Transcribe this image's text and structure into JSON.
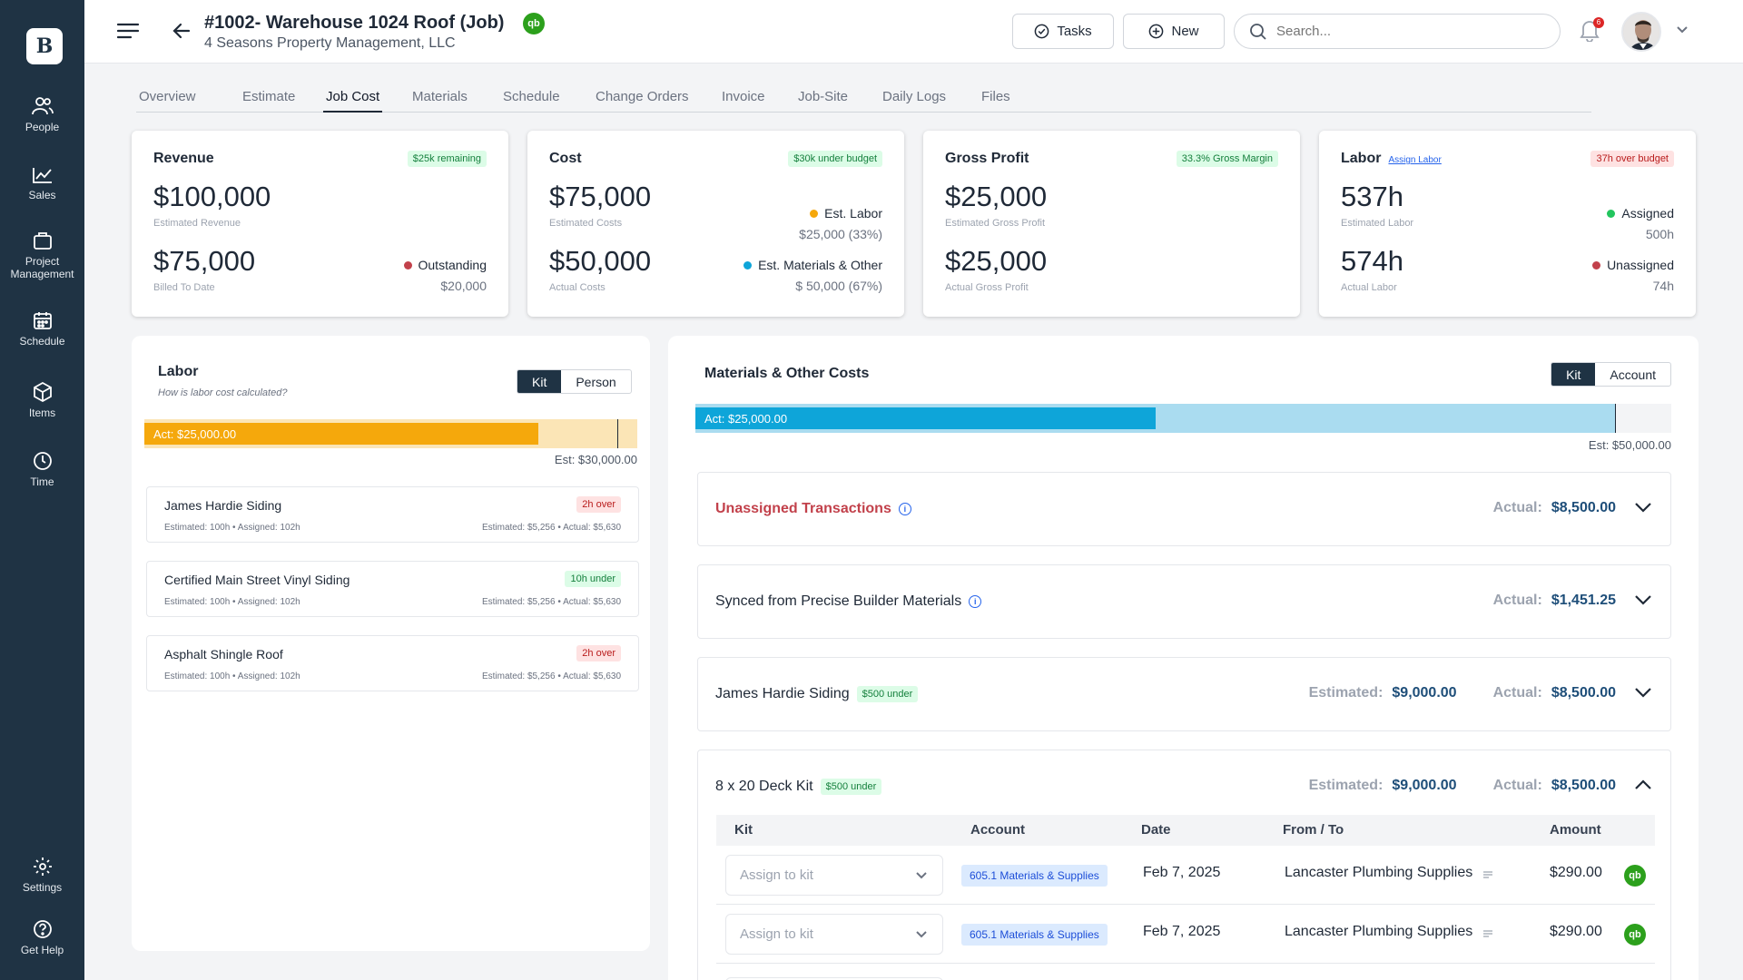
{
  "sidebar": {
    "logo": "B",
    "items": [
      {
        "label": "People",
        "icon": "people-icon"
      },
      {
        "label": "Sales",
        "icon": "chart-line-icon"
      },
      {
        "label": "Project Management",
        "icon": "briefcase-icon"
      },
      {
        "label": "Schedule",
        "icon": "calendar-icon"
      },
      {
        "label": "Items",
        "icon": "box-icon"
      },
      {
        "label": "Time",
        "icon": "clock-icon"
      },
      {
        "label": "Settings",
        "icon": "gear-icon"
      },
      {
        "label": "Get Help",
        "icon": "help-icon"
      }
    ]
  },
  "header": {
    "title": "#1002- Warehouse 1024 Roof (Job)",
    "subtitle": "4 Seasons Property Management, LLC",
    "qb_label": "qb",
    "tasks_label": "Tasks",
    "new_label": "New",
    "search_placeholder": "Search...",
    "notification_count": "6"
  },
  "tabs": [
    "Overview",
    "Estimate",
    "Job Cost",
    "Materials",
    "Schedule",
    "Change Orders",
    "Invoice",
    "Job-Site",
    "Daily Logs",
    "Files"
  ],
  "active_tab": "Job Cost",
  "cards": {
    "revenue": {
      "title": "Revenue",
      "pill": "$25k remaining",
      "est_value": "$100,000",
      "est_label": "Estimated Revenue",
      "act_value": "$75,000",
      "act_label": "Billed To Date",
      "legend": "Outstanding",
      "legend_value": "$20,000"
    },
    "cost": {
      "title": "Cost",
      "pill": "$30k under budget",
      "est_value": "$75,000",
      "est_label": "Estimated Costs",
      "act_value": "$50,000",
      "act_label": "Actual Costs",
      "legend1": "Est. Labor",
      "legend1_value": "$25,000 (33%)",
      "legend2": "Est. Materials & Other",
      "legend2_value": "$ 50,000 (67%)"
    },
    "gross": {
      "title": "Gross Profit",
      "pill": "33.3% Gross Margin",
      "est_value": "$25,000",
      "est_label": "Estimated Gross Profit",
      "act_value": "$25,000",
      "act_label": "Actual Gross Profit"
    },
    "labor": {
      "title": "Labor",
      "link": "Assign Labor",
      "pill": "37h over budget",
      "est_value": "537h",
      "est_label": "Estimated Labor",
      "act_value": "574h",
      "act_label": "Actual Labor",
      "legend1": "Assigned",
      "legend1_value": "500h",
      "legend2": "Unassigned",
      "legend2_value": "74h"
    }
  },
  "labor_panel": {
    "title": "Labor",
    "hint": "How is labor cost calculated?",
    "toggle": [
      "Kit",
      "Person"
    ],
    "bar_actual": "Act: $25,000.00",
    "bar_estimate": "Est: $30,000.00",
    "bar_fill_fraction": 0.833,
    "items": [
      {
        "name": "James Hardie Siding",
        "pill": "2h over",
        "status": "over",
        "hours": "Estimated: 100h  •  Assigned: 102h",
        "cost": "Estimated: $5,256  •  Actual: $5,630"
      },
      {
        "name": "Certified Main Street Vinyl Siding",
        "pill": "10h under",
        "status": "under",
        "hours": "Estimated: 100h  •  Assigned: 102h",
        "cost": "Estimated: $5,256  •  Actual: $5,630"
      },
      {
        "name": "Asphalt Shingle Roof",
        "pill": "2h over",
        "status": "over",
        "hours": "Estimated: 100h  •  Assigned: 102h",
        "cost": "Estimated: $5,256  •  Actual: $5,630"
      }
    ]
  },
  "materials_panel": {
    "title": "Materials & Other Costs",
    "toggle": [
      "Kit",
      "Account"
    ],
    "bar_actual": "Act: $25,000.00",
    "bar_estimate": "Est: $50,000.00",
    "bar_fill_fraction": 0.5,
    "actual_label": "Actual:",
    "estimated_label": "Estimated:",
    "rows": [
      {
        "name": "Unassigned Transactions",
        "actual": "$8,500.00"
      },
      {
        "name": "Synced from Precise Builder Materials",
        "actual": "$1,451.25"
      },
      {
        "name": "James Hardie Siding",
        "pill": "$500 under",
        "estimated": "$9,000.00",
        "actual": "$8,500.00"
      },
      {
        "name": "8 x 20 Deck Kit",
        "pill": "$500 under",
        "estimated": "$9,000.00",
        "actual": "$8,500.00"
      }
    ],
    "table": {
      "headers": [
        "Kit",
        "Account",
        "Date",
        "From / To",
        "Amount"
      ],
      "rows": [
        {
          "kit_placeholder": "Assign to kit",
          "account": "605.1 Materials & Supplies",
          "date": "Feb 7, 2025",
          "from_to": "Lancaster Plumbing Supplies",
          "amount": "$290.00"
        },
        {
          "kit_placeholder": "Assign to kit",
          "account": "605.1 Materials & Supplies",
          "date": "Feb 7, 2025",
          "from_to": "Lancaster Plumbing Supplies",
          "amount": "$290.00"
        }
      ]
    }
  },
  "colors": {
    "sidebar": "#1f3344",
    "labor_bar": "#f5a80c",
    "labor_track": "#fbe5b6",
    "materials_bar": "#0ea5d9",
    "materials_track": "#aadcf0",
    "qb_green": "#2ca01c"
  }
}
